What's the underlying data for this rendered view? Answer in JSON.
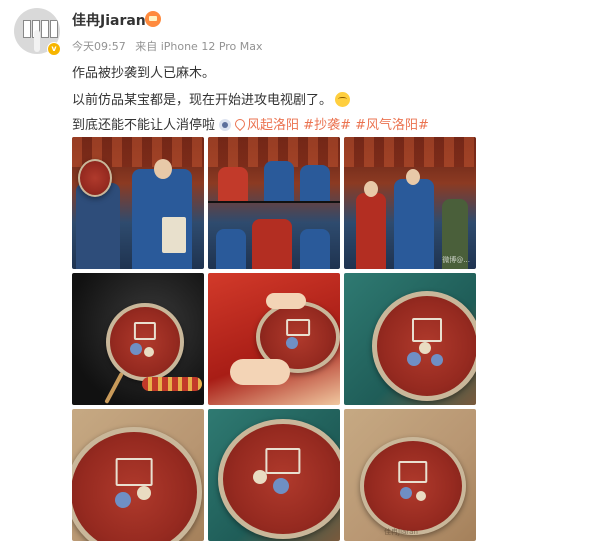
{
  "post": {
    "username": "佳冉Jiaran",
    "time": "今天09:57",
    "source": "来自 iPhone 12 Pro Max",
    "text_line1": "作品被抄袭到人已麻木。",
    "text_line2": "以前仿品某宝都是，现在开始进攻电视剧了。",
    "text_line3_prefix": "到底还能不能让人消停啦",
    "location_tag": "风起洛阳",
    "hashtag1": "#抄袭#",
    "hashtag2": "#风气洛阳#"
  },
  "photos": [
    {
      "name": "drama-still-bride-fan"
    },
    {
      "name": "drama-still-collage"
    },
    {
      "name": "drama-still-ceremony"
    },
    {
      "name": "fan-on-dark-background"
    },
    {
      "name": "fan-held-red-dress"
    },
    {
      "name": "fan-on-teal-cloth"
    },
    {
      "name": "fan-closeup-tan"
    },
    {
      "name": "fan-closeup-teal"
    },
    {
      "name": "fan-on-tan-paper"
    }
  ],
  "watermarks": {
    "w3": "微博@...",
    "w9": "佳冉Jiaran"
  },
  "colors": {
    "link": "#eb7350",
    "meta": "#939393",
    "text": "#333333",
    "vip_badge": "#f7b500"
  }
}
